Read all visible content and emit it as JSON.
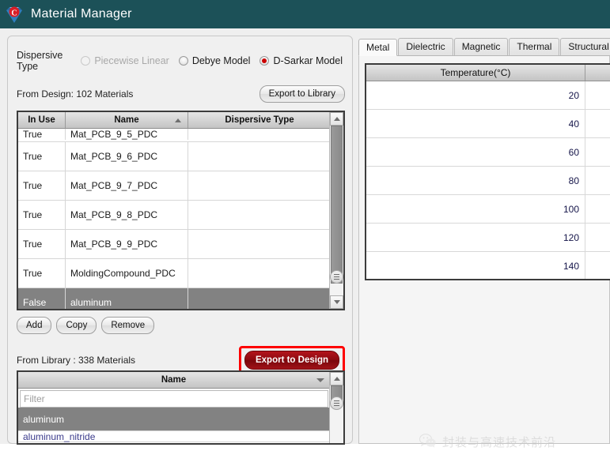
{
  "window": {
    "title": "Material Manager",
    "icon": "cadence-gem-icon",
    "titlebar_color": "#1c5158"
  },
  "left_panel": {
    "dispersive": {
      "label": "Dispersive Type",
      "options": [
        {
          "label": "Piecewise Linear",
          "selected": false,
          "disabled": true
        },
        {
          "label": "Debye Model",
          "selected": false,
          "disabled": false
        },
        {
          "label": "D-Sarkar Model",
          "selected": true,
          "disabled": false
        }
      ],
      "accent_color": "#cc0000"
    },
    "from_design": {
      "summary": "From Design: 102 Materials",
      "export_button": "Export to Library"
    },
    "design_table": {
      "columns": [
        "In Use",
        "Name",
        "Dispersive Type"
      ],
      "sort_column": "Name",
      "rows": [
        {
          "in_use": "True",
          "name": "Mat_PCB_9_5_PDC",
          "dispersive": "",
          "selected": false,
          "clipped": true
        },
        {
          "in_use": "True",
          "name": "Mat_PCB_9_6_PDC",
          "dispersive": "",
          "selected": false,
          "clipped": false
        },
        {
          "in_use": "True",
          "name": "Mat_PCB_9_7_PDC",
          "dispersive": "",
          "selected": false,
          "clipped": false
        },
        {
          "in_use": "True",
          "name": "Mat_PCB_9_8_PDC",
          "dispersive": "",
          "selected": false,
          "clipped": false
        },
        {
          "in_use": "True",
          "name": "Mat_PCB_9_9_PDC",
          "dispersive": "",
          "selected": false,
          "clipped": false
        },
        {
          "in_use": "True",
          "name": "MoldingCompound_PDC",
          "dispersive": "",
          "selected": false,
          "clipped": false
        },
        {
          "in_use": "False",
          "name": "aluminum",
          "dispersive": "",
          "selected": true,
          "clipped": false
        }
      ]
    },
    "action_buttons": [
      {
        "label": "Add"
      },
      {
        "label": "Copy"
      },
      {
        "label": "Remove"
      }
    ],
    "from_library": {
      "summary": "From Library : 338 Materials",
      "export_button": "Export to Design",
      "export_button_color": "#8d0a10",
      "highlight_color": "#fe0000"
    },
    "library_table": {
      "column": "Name",
      "filter_placeholder": "Filter",
      "rows": [
        {
          "name": "aluminum",
          "selected": true
        },
        {
          "name": "aluminum_nitride",
          "selected": false
        }
      ]
    }
  },
  "right_panel": {
    "tabs": [
      {
        "label": "Metal",
        "active": true
      },
      {
        "label": "Dielectric",
        "active": false
      },
      {
        "label": "Magnetic",
        "active": false
      },
      {
        "label": "Thermal",
        "active": false
      },
      {
        "label": "Structural",
        "active": false
      }
    ],
    "property_table": {
      "columns": [
        "Temperature(°C)",
        ""
      ],
      "rows": [
        {
          "temperature": "20"
        },
        {
          "temperature": "40"
        },
        {
          "temperature": "60"
        },
        {
          "temperature": "80"
        },
        {
          "temperature": "100"
        },
        {
          "temperature": "120"
        },
        {
          "temperature": "140"
        }
      ]
    }
  },
  "watermark": {
    "icon": "wechat-icon",
    "text": "封装与高速技术前沿"
  }
}
